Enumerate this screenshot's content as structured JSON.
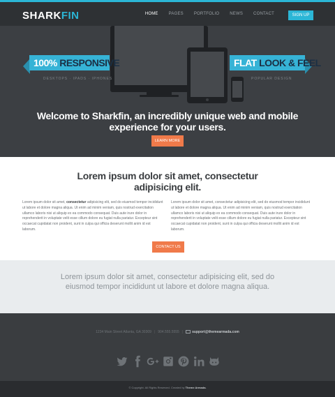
{
  "header": {
    "logo_main": "SHARK",
    "logo_accent": "FIN",
    "nav": [
      {
        "label": "HOME"
      },
      {
        "label": "PAGES"
      },
      {
        "label": "PORTFOLIO"
      },
      {
        "label": "NEWS"
      },
      {
        "label": "CONTACT"
      }
    ],
    "signup_label": "SIGN UP"
  },
  "hero": {
    "ribbon_left_accent": "100%",
    "ribbon_left_text": "RESPONSIVE",
    "ribbon_left_sub": "DESKTOPS · IPADS · IPHONES",
    "ribbon_right_accent": "FLAT",
    "ribbon_right_text": "LOOK & FEEL",
    "ribbon_right_sub": "POPULAR DESIGN",
    "title": "Welcome to Sharkfin, an incredibly unique web and mobile experience for your users.",
    "cta_label": "LEARN MORE"
  },
  "content": {
    "title": "Lorem ipsum dolor sit amet, consectetur adipisicing elit.",
    "col_left_intro": "Lorem ipsum dolor sit amet, ",
    "col_left_bold": "consectetur",
    "col_left_rest": " adipisicing elit, sed do eiusmod tempor incididunt ut labore et dolore magna aliqua. Ut enim ad minim veniam, quis nostrud exercitation ullamco laboris nisi ut aliquip ex ea commodo consequat. Duis aute irure dolor in reprehenderit in voluptate velit esse cillum dolore eu fugiat nulla pariatur. Excepteur sint occaecat cupidatat non proident, sunt in culpa qui officia deserunt mollit anim id est laborum.",
    "col_right": "Lorem ipsum dolor sit amet, consectetur adipisicing elit, sed do eiusmod tempor incididunt ut labore et dolore magna aliqua. Ut enim ad minim veniam, quis nostrud exercitation ullamco laboris nisi ut aliquip ex ea commodo consequat. Duis aute irure dolor in reprehenderit in voluptate velit esse cillum dolore eu fugiat nulla pariatur. Excepteur sint occaecat cupidatat non proident, sunt in culpa qui officia deserunt mollit anim id est laborum.",
    "contact_label": "CONTACT US"
  },
  "quote": {
    "text": "Lorem ipsum dolor sit amet, consectetur adipisicing elit, sed do eiusmod tempor incididunt ut labore et dolore magna aliqua."
  },
  "footer": {
    "address": "1234 Main Street Atlanta, GA 30309",
    "phone": "904.555.5555",
    "email": "support@themearmada.com",
    "social_icons": [
      "twitter-icon",
      "facebook-icon",
      "google-plus-icon",
      "instagram-icon",
      "pinterest-icon",
      "linkedin-icon",
      "github-icon"
    ],
    "copyright_text": "© Copyright. All Rights Reserved. Created by ",
    "copyright_author": "Theme Armada."
  },
  "colors": {
    "accent": "#2bb6d6",
    "cta": "#f07a4a",
    "dark": "#3a3d40"
  }
}
